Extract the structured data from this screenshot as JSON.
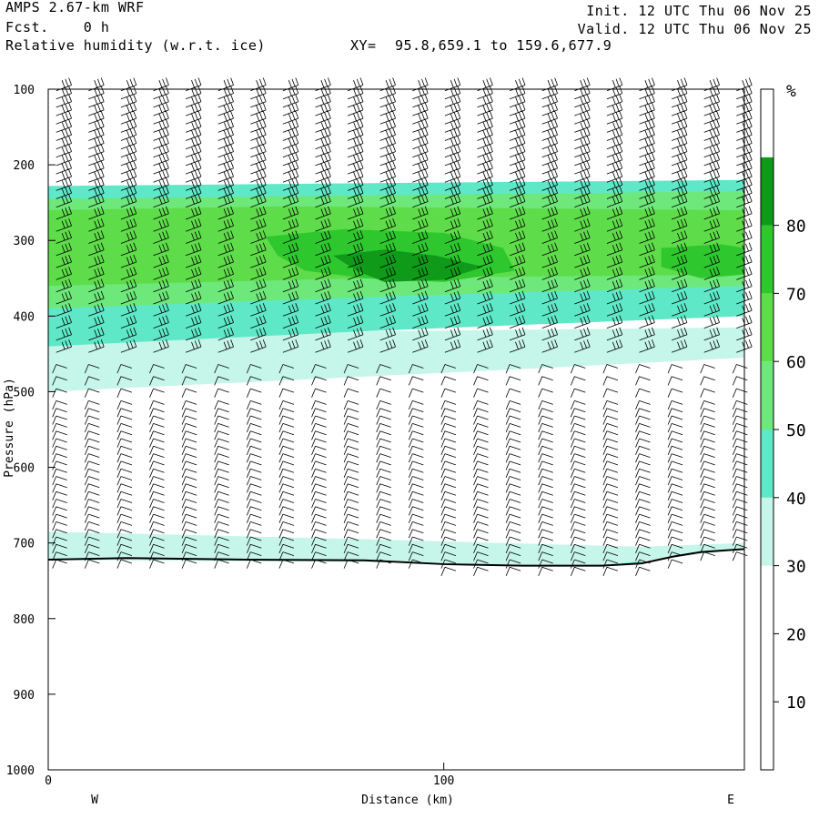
{
  "header": {
    "model": "AMPS 2.67-km WRF",
    "fcst": "Fcst.    0 h",
    "field": "Relative humidity (w.r.t. ice)",
    "xy_label": "XY=",
    "xy_value": "95.8,659.1 to 159.6,677.9",
    "init": "Init. 12 UTC Thu 06 Nov 25",
    "valid": "Valid. 12 UTC Thu 06 Nov 25"
  },
  "colors": {
    "rh_30_40": "#c6f5ea",
    "rh_40_50": "#5ee8c8",
    "rh_50_60": "#6ee87a",
    "rh_60_70": "#5fdc4a",
    "rh_70_80": "#2ec82e",
    "rh_80_90": "#0f9a1a"
  },
  "chart_data": {
    "type": "heatmap",
    "ylabel": "Pressure (hPa)",
    "xlabel": "Distance (km)",
    "ylim": [
      100,
      1000
    ],
    "xlim": [
      0,
      176
    ],
    "y_ticks": [
      "100",
      "200",
      "300",
      "400",
      "500",
      "600",
      "700",
      "800",
      "900",
      "1000"
    ],
    "x_ticks": [
      "0",
      "100"
    ],
    "x_tick_values": [
      0,
      100
    ],
    "x_end_labels": {
      "left": "W",
      "right": "E"
    },
    "colorbar": {
      "unit": "%",
      "levels": [
        0,
        10,
        20,
        30,
        40,
        50,
        60,
        70,
        80,
        90
      ],
      "labels": [
        "10",
        "20",
        "30",
        "40",
        "50",
        "60",
        "70",
        "80"
      ]
    },
    "layers": [
      {
        "min": 30,
        "max": 40,
        "top": [
          [
            0,
            425
          ],
          [
            176,
            415
          ]
        ],
        "bottom": [
          [
            0,
            500
          ],
          [
            60,
            485
          ],
          [
            120,
            470
          ],
          [
            176,
            455
          ]
        ]
      },
      {
        "min": 40,
        "max": 50,
        "top": [
          [
            0,
            228
          ],
          [
            176,
            220
          ]
        ],
        "bottom": [
          [
            0,
            440
          ],
          [
            80,
            420
          ],
          [
            176,
            400
          ]
        ]
      },
      {
        "min": 50,
        "max": 60,
        "top": [
          [
            0,
            245
          ],
          [
            176,
            235
          ]
        ],
        "bottom": [
          [
            0,
            390
          ],
          [
            80,
            375
          ],
          [
            176,
            360
          ]
        ]
      },
      {
        "min": 60,
        "max": 70,
        "top": [
          [
            0,
            260
          ],
          [
            60,
            255
          ],
          [
            176,
            260
          ]
        ],
        "bottom": [
          [
            0,
            360
          ],
          [
            80,
            350
          ],
          [
            176,
            345
          ]
        ]
      },
      {
        "min": 40,
        "max": 50,
        "top": [
          [
            0,
            690
          ],
          [
            80,
            700
          ],
          [
            140,
            710
          ],
          [
            150,
            715
          ]
        ],
        "bottom": [
          [
            0,
            722
          ],
          [
            80,
            725
          ],
          [
            140,
            730
          ],
          [
            150,
            728
          ]
        ]
      },
      {
        "min": 30,
        "max": 40,
        "top": [
          [
            0,
            685
          ],
          [
            80,
            695
          ],
          [
            150,
            705
          ],
          [
            176,
            700
          ]
        ],
        "bottom": [
          [
            0,
            722
          ],
          [
            80,
            725
          ],
          [
            140,
            730
          ],
          [
            176,
            708
          ]
        ]
      }
    ],
    "blobs": [
      {
        "min": 70,
        "max": 80,
        "points": [
          [
            55,
            295
          ],
          [
            75,
            285
          ],
          [
            100,
            290
          ],
          [
            115,
            310
          ],
          [
            118,
            340
          ],
          [
            100,
            355
          ],
          [
            80,
            350
          ],
          [
            65,
            340
          ],
          [
            58,
            320
          ]
        ]
      },
      {
        "min": 80,
        "max": 90,
        "points": [
          [
            72,
            320
          ],
          [
            85,
            312
          ],
          [
            98,
            320
          ],
          [
            110,
            335
          ],
          [
            100,
            352
          ],
          [
            85,
            355
          ],
          [
            78,
            340
          ]
        ]
      },
      {
        "min": 70,
        "max": 80,
        "points": [
          [
            155,
            310
          ],
          [
            170,
            305
          ],
          [
            176,
            310
          ],
          [
            176,
            345
          ],
          [
            165,
            350
          ],
          [
            155,
            335
          ]
        ]
      }
    ],
    "terrain": [
      [
        0,
        722
      ],
      [
        20,
        720
      ],
      [
        50,
        722
      ],
      [
        80,
        723
      ],
      [
        100,
        728
      ],
      [
        120,
        730
      ],
      [
        140,
        730
      ],
      [
        150,
        727
      ],
      [
        158,
        718
      ],
      [
        165,
        712
      ],
      [
        176,
        708
      ]
    ]
  }
}
